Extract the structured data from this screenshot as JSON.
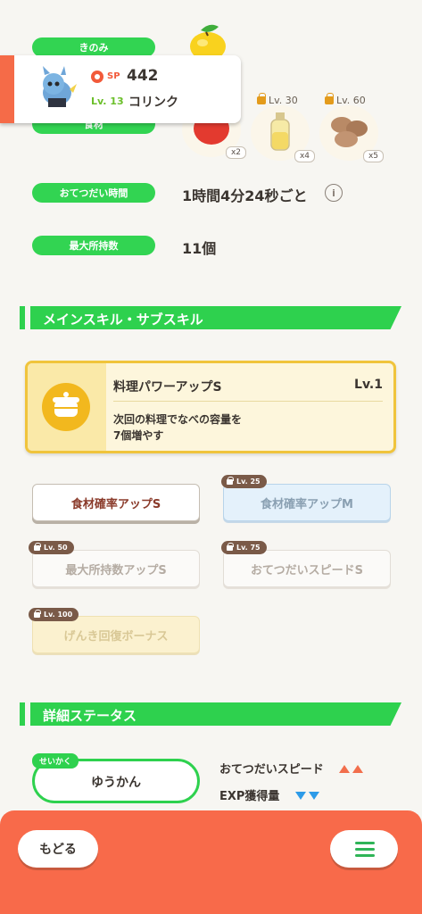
{
  "berry_section": {
    "label": "きのみ"
  },
  "ingredients": {
    "label": "食材",
    "items": [
      {
        "name": "tomato",
        "count": "x2",
        "lock_level": ""
      },
      {
        "name": "oil",
        "count": "x4",
        "lock_level": "Lv. 30"
      },
      {
        "name": "potato",
        "count": "x5",
        "lock_level": "Lv. 60"
      }
    ]
  },
  "pokemon": {
    "sp_label": "SP",
    "sp_value": "442",
    "level": "Lv. 13",
    "name": "コリンク"
  },
  "help_time": {
    "label": "おてつだい時間",
    "value": "1時間4分24秒ごと",
    "info": "i"
  },
  "max_carry": {
    "label": "最大所持数",
    "value": "11個"
  },
  "skills_section": {
    "title": "メインスキル・サブスキル"
  },
  "main_skill": {
    "name": "料理パワーアップS",
    "level": "Lv.1",
    "description_line1": "次回の料理でなべの容量を",
    "description_line2": "7個増やす"
  },
  "sub_skills": [
    {
      "label": "食材確率アップS",
      "lock": ""
    },
    {
      "label": "食材確率アップM",
      "lock": "Lv. 25"
    },
    {
      "label": "最大所持数アップS",
      "lock": "Lv. 50"
    },
    {
      "label": "おてつだいスピードS",
      "lock": "Lv. 75"
    },
    {
      "label": "げんき回復ボーナス",
      "lock": "Lv. 100"
    }
  ],
  "details_section": {
    "title": "詳細ステータス"
  },
  "nature": {
    "tag": "せいかく",
    "value": "ゆうかん",
    "up_stat": "おてつだいスピード",
    "down_stat": "EXP獲得量"
  },
  "footer": {
    "back_label": "もどる"
  },
  "colors": {
    "green": "#2ed14e",
    "orange": "#f86a4a",
    "gold": "#f0c43c"
  }
}
